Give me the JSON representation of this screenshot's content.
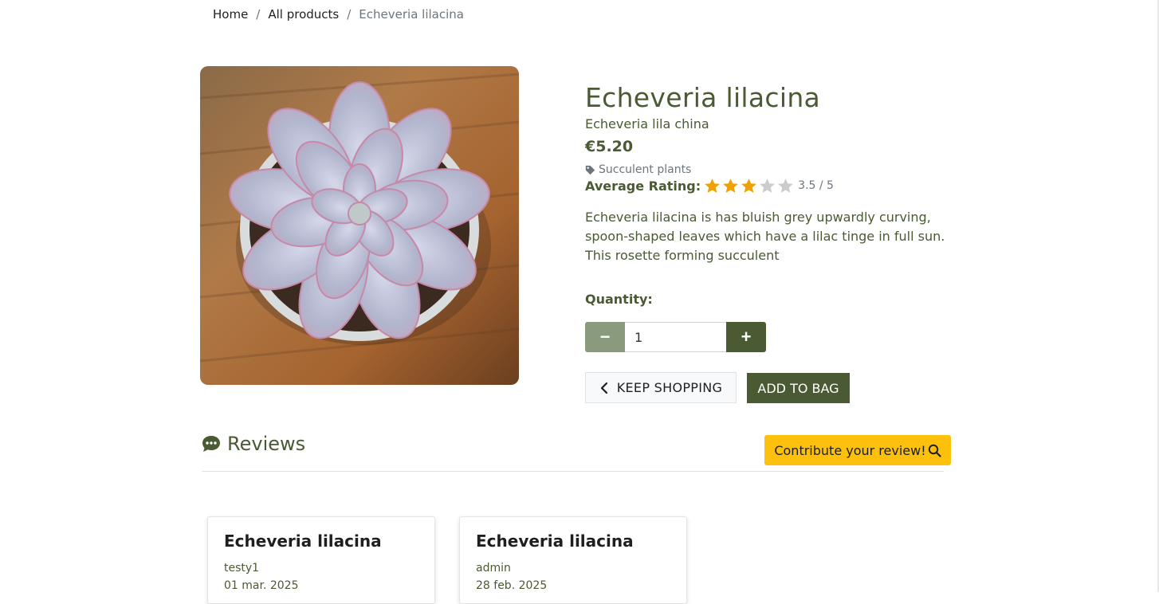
{
  "breadcrumb": {
    "home": "Home",
    "all_products": "All products",
    "current": "Echeveria lilacina",
    "separator": "/"
  },
  "product": {
    "name": "Echeveria lilacina",
    "latin_name": "Echeveria lila china",
    "price": "€5.20",
    "category": "Succulent plants",
    "rating_label": "Average Rating:",
    "rating": 3.5,
    "rating_max": 5,
    "rating_text": "3.5 / 5",
    "description": "Echeveria lilacina is has bluish grey upwardly curving, spoon-shaped leaves which have a lilac tinge in full sun. This rosette forming succulent",
    "quantity_label": "Quantity:",
    "quantity_value": "1",
    "minus_symbol": "−",
    "plus_symbol": "+",
    "keep_shopping_label": "KEEP SHOPPING",
    "add_to_bag_label": "ADD TO BAG"
  },
  "reviews": {
    "heading": "Reviews",
    "contribute_label": "Contribute your review!",
    "items": [
      {
        "title": "Echeveria lilacina",
        "user": "testy1",
        "date": "01 mar. 2025"
      },
      {
        "title": "Echeveria lilacina",
        "user": "admin",
        "date": "28 feb. 2025"
      }
    ]
  },
  "colors": {
    "brand_green": "#4a5a33",
    "muted_green": "#8a9a7d",
    "star_filled": "#f0a202",
    "star_empty": "#cccccc",
    "contribute_yellow": "#fcc00d"
  },
  "icons": {
    "category": "tag-icon",
    "back": "chevron-left-icon",
    "reviews": "comment-dots-icon",
    "contribute": "search-icon"
  }
}
